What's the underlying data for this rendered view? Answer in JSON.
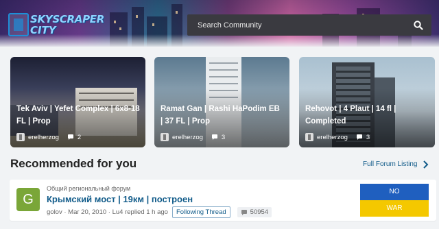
{
  "header": {
    "logo_line1": "SKYSCRAPER",
    "logo_line2": "CITY",
    "search_placeholder": "Search Community",
    "search_icon": "search-icon"
  },
  "cards": [
    {
      "title": "Tek Aviv | Yefet Complex | 6x8-18 FL | Prop",
      "author": "erelherzog",
      "comments": "2",
      "colors": [
        "#1f2238",
        "#6b6a7e",
        "#a59a7c"
      ]
    },
    {
      "title": "Ramat Gan | Rashi HaPodim EB | 37 FL | Prop",
      "author": "erelherzog",
      "comments": "3",
      "colors": [
        "#5d7b92",
        "#b8c6cf",
        "#d9dfe3"
      ]
    },
    {
      "title": "Rehovot | 4 Plaut | 14 fl | Completed",
      "author": "erelherzog",
      "comments": "3",
      "colors": [
        "#9ab4c6",
        "#4a5663",
        "#2b3036"
      ]
    }
  ],
  "recommended": {
    "title": "Recommended for you",
    "full_listing": "Full Forum Listing"
  },
  "thread": {
    "avatar_letter": "G",
    "forum": "Общий региональный форум",
    "title": "Крымский мост | 19км | построен",
    "author": "golov",
    "date": "Mar 20, 2010",
    "last_reply": "Lu4 replied 1 h ago",
    "following": "Following Thread",
    "replies": "50954"
  },
  "flag": {
    "top_text": "NO",
    "bottom_text": "WAR",
    "top_color": "#1f5fbf",
    "bottom_color": "#f4c800"
  }
}
